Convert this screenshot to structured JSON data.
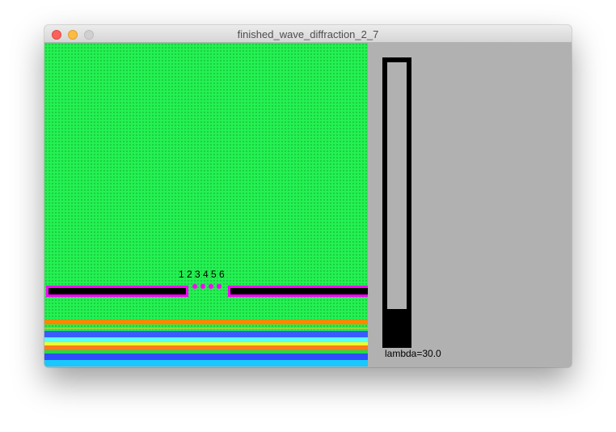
{
  "window": {
    "title": "finished_wave_diffraction_2_7",
    "controls": [
      "close",
      "minimize",
      "zoom"
    ]
  },
  "simulation": {
    "background_color": "#24f152",
    "barrier_color": "#000000",
    "barrier_outline_color": "#ff00ff",
    "slit_color": "#ff00ff",
    "slit_labels": [
      "1",
      "2",
      "3",
      "4",
      "5",
      "6"
    ],
    "wave_band_colors": [
      "#ff8800",
      "#3a5cff",
      "#0a2cff",
      "#55ffff",
      "#f2ff2a",
      "#ff7a1a",
      "#19e04a",
      "#2f4dff",
      "#18c8ff"
    ]
  },
  "control_panel": {
    "background_color": "#b1b1b1",
    "lambda_label": "lambda=30.0",
    "slider_level": 0.12
  }
}
